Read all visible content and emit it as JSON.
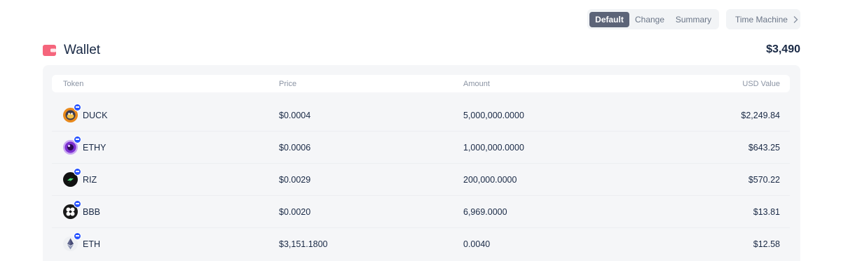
{
  "toolbar": {
    "tabs": [
      {
        "label": "Default",
        "active": true
      },
      {
        "label": "Change",
        "active": false
      },
      {
        "label": "Summary",
        "active": false
      }
    ],
    "time_machine_label": "Time Machine",
    "time_machine_icon": "chevron-right-icon"
  },
  "wallet": {
    "icon": "wallet-icon",
    "icon_color": "#f5657c",
    "title": "Wallet",
    "total": "$3,490"
  },
  "table": {
    "headers": {
      "token": "Token",
      "price": "Price",
      "amount": "Amount",
      "usd_value": "USD Value"
    },
    "rows": [
      {
        "symbol": "DUCK",
        "price": "$0.0004",
        "amount": "5,000,000.0000",
        "usd_value": "$2,249.84",
        "logo": "duck-token-icon",
        "chain_badge": "base-chain-icon"
      },
      {
        "symbol": "ETHY",
        "price": "$0.0006",
        "amount": "1,000,000.0000",
        "usd_value": "$643.25",
        "logo": "ethy-token-icon",
        "chain_badge": "base-chain-icon"
      },
      {
        "symbol": "RIZ",
        "price": "$0.0029",
        "amount": "200,000.0000",
        "usd_value": "$570.22",
        "logo": "riz-token-icon",
        "chain_badge": "base-chain-icon"
      },
      {
        "symbol": "BBB",
        "price": "$0.0020",
        "amount": "6,969.0000",
        "usd_value": "$13.81",
        "logo": "bbb-token-icon",
        "chain_badge": "base-chain-icon"
      },
      {
        "symbol": "ETH",
        "price": "$3,151.1800",
        "amount": "0.0040",
        "usd_value": "$12.58",
        "logo": "eth-token-icon",
        "chain_badge": "base-chain-icon"
      }
    ]
  },
  "colors": {
    "active_tab": "#5c6478",
    "chain_badge": "#2954ff",
    "panel_bg": "#f5f6f8",
    "text_primary": "#192945",
    "text_muted": "#8a93a3"
  }
}
